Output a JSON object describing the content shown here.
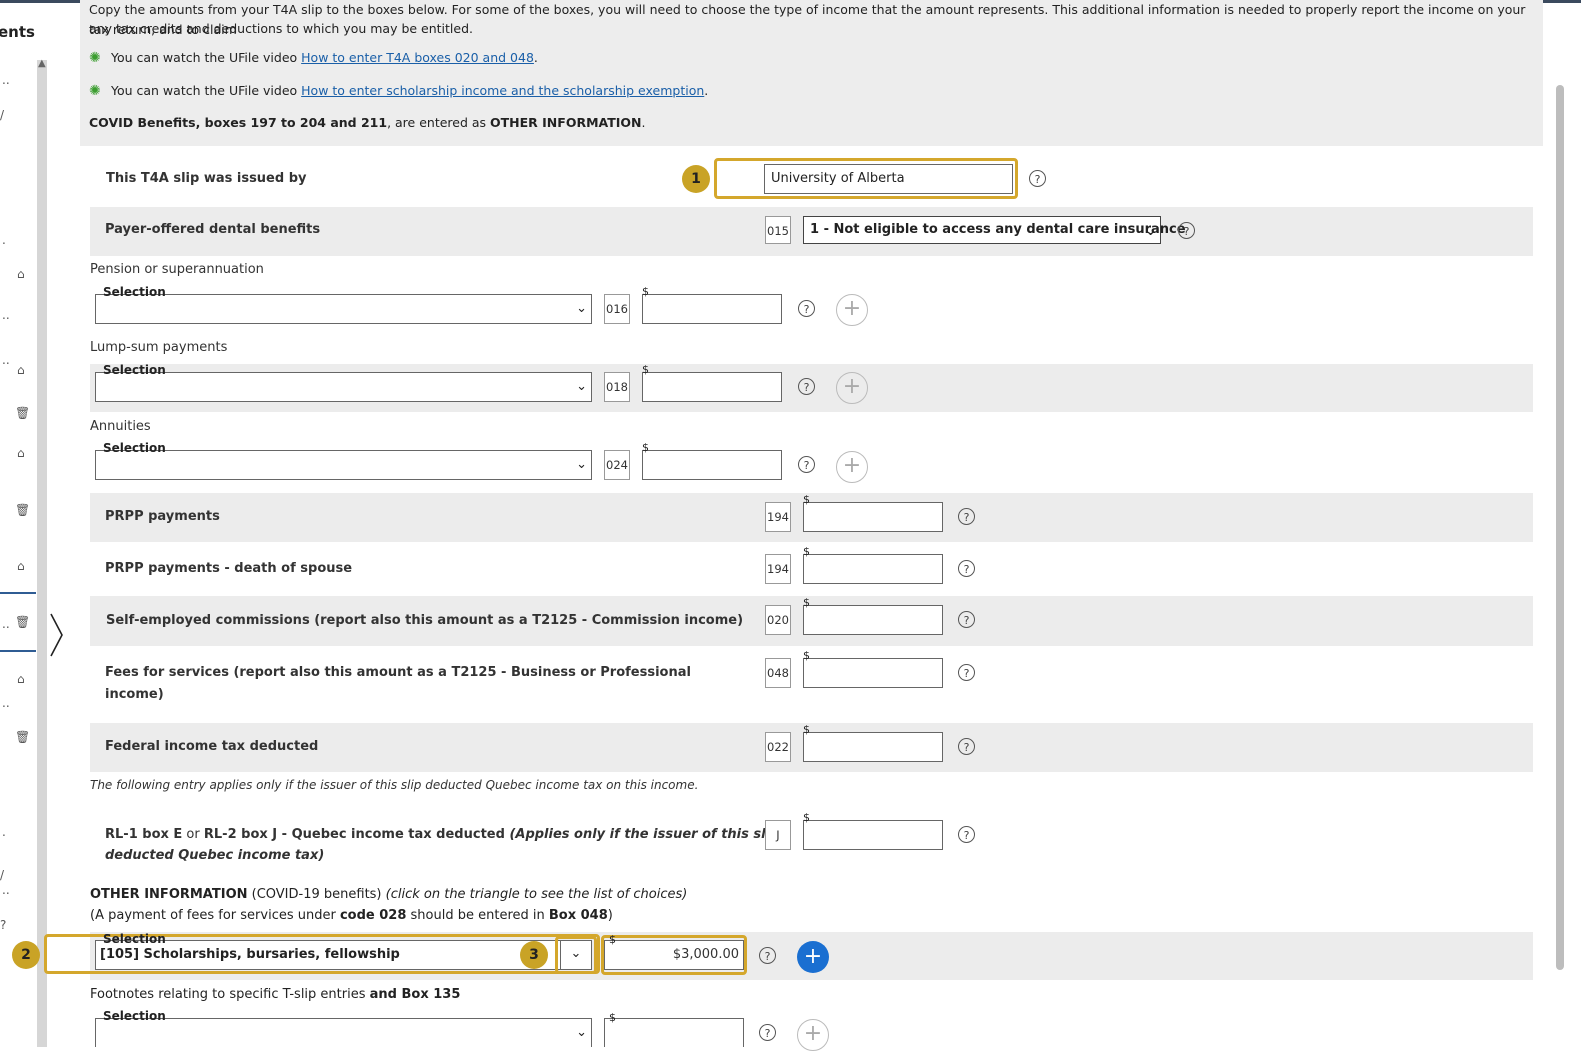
{
  "sidebar": {
    "title_fragment": "ents"
  },
  "info": {
    "intro_line1": "Copy the amounts from your T4A slip to the boxes below. For some of the boxes, you will need to choose the type of income that the amount represents. This additional information is needed to properly report the income on your tax return, and to claim",
    "intro_line2": "any tax credits and deductions to which you may be entitled.",
    "video1_prefix": "You can watch the UFile video",
    "video1_link": "How to enter T4A boxes 020 and 048",
    "video2_prefix": "You can watch the UFile video",
    "video2_link": "How to enter scholarship income and the scholarship exemption",
    "covid_bold1": "COVID Benefits, boxes 197 to 204 and 211",
    "covid_mid": ", are entered as ",
    "covid_bold2": "OTHER INFORMATION",
    "covid_end": "."
  },
  "issuer": {
    "label": "This T4A slip was issued by",
    "value": "University of Alberta",
    "badge": "1"
  },
  "dental": {
    "label": "Payer-offered dental benefits",
    "box": "015",
    "selected": "1 - Not eligible to access any dental care insurance"
  },
  "pension": {
    "heading": "Pension or superannuation",
    "select_caption": "Selection",
    "box": "016",
    "currency": "$"
  },
  "lumpsum": {
    "heading": "Lump-sum payments",
    "select_caption": "Selection",
    "box": "018",
    "currency": "$"
  },
  "annuities": {
    "heading": "Annuities",
    "select_caption": "Selection",
    "box": "024",
    "currency": "$"
  },
  "prpp": {
    "label": "PRPP payments",
    "box": "194",
    "currency": "$"
  },
  "prpp_death": {
    "label": "PRPP payments - death of spouse",
    "box": "194",
    "currency": "$"
  },
  "commissions": {
    "label": "Self-employed commissions (report also this amount as a T2125 - Commission income)",
    "box": "020",
    "currency": "$"
  },
  "fees": {
    "label_line1": "Fees for services (report also this amount as a T2125 - Business or Professional",
    "label_line2": "income)",
    "box": "048",
    "currency": "$"
  },
  "federal_tax": {
    "label": "Federal income tax deducted",
    "box": "022",
    "currency": "$"
  },
  "quebec_note": "The following entry applies only if the issuer of this slip deducted Quebec income tax on this income.",
  "quebec": {
    "b1": "RL-1 box E",
    "or1": " or ",
    "b2": "RL-2 box J",
    "mid": " - Quebec income tax deducted ",
    "italic1": "(Applies only if the issuer of this slip",
    "italic2": "deducted Quebec income tax)",
    "box": "J",
    "currency": "$"
  },
  "other_info": {
    "bold": "OTHER INFORMATION",
    "plain": " (COVID-19 benefits) ",
    "italic": "(click on the triangle to see the list of choices)",
    "note_a": "(A payment of fees for services under ",
    "note_b": "code 028",
    "note_c": " should be entered in ",
    "note_d": "Box 048",
    "note_e": ")",
    "select_caption": "Selection",
    "selected": "[105] Scholarships, bursaries, fellowship",
    "currency": "$",
    "amount": "$3,000.00",
    "badge2": "2",
    "badge3": "3"
  },
  "footnotes": {
    "plain": "Footnotes relating to specific T-slip entries ",
    "bold": "and Box 135",
    "select_caption": "Selection",
    "currency": "$"
  },
  "icons": {
    "help": "?",
    "add": "+",
    "chevron": "⌄"
  }
}
